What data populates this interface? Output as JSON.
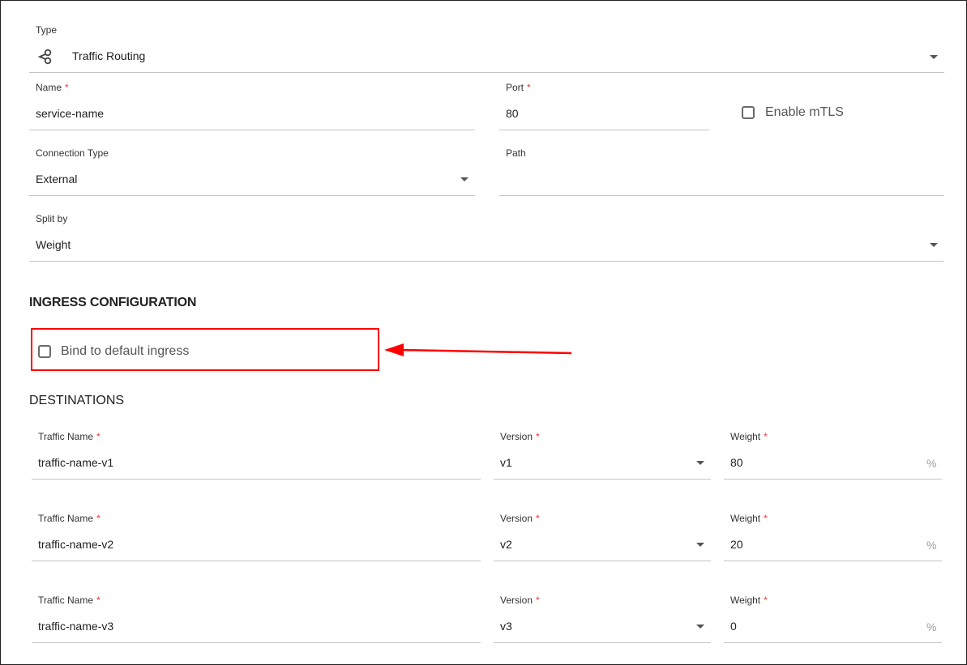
{
  "type_field": {
    "label": "Type",
    "value": "Traffic Routing",
    "icon": "share-nodes-icon"
  },
  "name_field": {
    "label": "Name",
    "required": "*",
    "value": "service-name"
  },
  "port_field": {
    "label": "Port",
    "required": "*",
    "value": "80"
  },
  "mtls": {
    "label": "Enable mTLS",
    "checked": false
  },
  "connection_type": {
    "label": "Connection Type",
    "value": "External"
  },
  "path_field": {
    "label": "Path",
    "value": ""
  },
  "split_by": {
    "label": "Split by",
    "value": "Weight"
  },
  "ingress": {
    "heading": "INGRESS CONFIGURATION",
    "bind_label": "Bind to default ingress",
    "checked": false
  },
  "annotation": {
    "color": "#ff0000"
  },
  "destinations": {
    "heading": "DESTINATIONS",
    "rows": [
      {
        "traffic_label": "Traffic Name",
        "traffic_value": "traffic-name-v1",
        "version_label": "Version",
        "version_value": "v1",
        "weight_label": "Weight",
        "weight_value": "80",
        "suffix": "%"
      },
      {
        "traffic_label": "Traffic Name",
        "traffic_value": "traffic-name-v2",
        "version_label": "Version",
        "version_value": "v2",
        "weight_label": "Weight",
        "weight_value": "20",
        "suffix": "%"
      },
      {
        "traffic_label": "Traffic Name",
        "traffic_value": "traffic-name-v3",
        "version_label": "Version",
        "version_value": "v3",
        "weight_label": "Weight",
        "weight_value": "0",
        "suffix": "%"
      }
    ],
    "required": "*"
  }
}
